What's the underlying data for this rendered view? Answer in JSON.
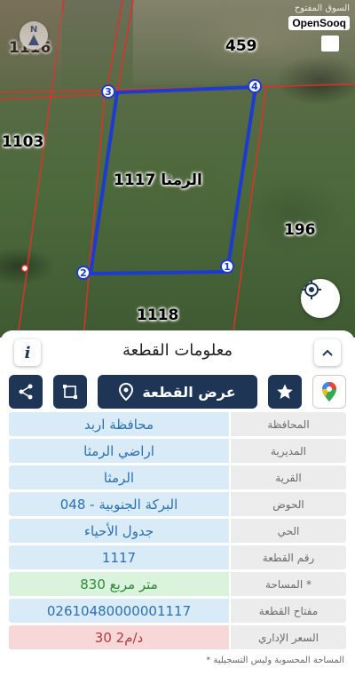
{
  "map": {
    "parcel_numbers": {
      "n1116": "1116",
      "n459": "459",
      "n1103": "1103",
      "n196": "196",
      "n1118": "1118"
    },
    "selected_parcel_label": "الرمثا 1117",
    "vertices": [
      "1",
      "2",
      "3",
      "4"
    ],
    "north_label": "N",
    "watermark_ar": "السوق المفتوح",
    "watermark_en": "OpenSooq",
    "colors": {
      "parcel_outline": "#1d3bd1",
      "boundary": "#e0302a"
    }
  },
  "sheet": {
    "title": "معلومات القطعة",
    "show_plot_label": "عرض القطعة",
    "rows": [
      {
        "label": "المحافظة",
        "value": "محافظة اربد"
      },
      {
        "label": "المديرية",
        "value": "اراضي الرمثا"
      },
      {
        "label": "القرية",
        "value": "الرمثا"
      },
      {
        "label": "الحوض",
        "value": "البركة الجنوبية - 048"
      },
      {
        "label": "الحي",
        "value": "جدول الأحياء"
      },
      {
        "label": "رقم القطعة",
        "value": "1117"
      },
      {
        "label": "المساحة *",
        "value": "830  متر مربع"
      },
      {
        "label": "مفتاح القطعة",
        "value": "02610480000001117"
      },
      {
        "label": "السعر الإداري",
        "value": "30 د/م2"
      }
    ],
    "footnote": "* المساحة المحسوبة وليس التسجيلية",
    "colors": {
      "primary": "#1e3556",
      "value_bg": "#d9ebf6",
      "area_bg": "#d9f3dc",
      "price_bg": "#f8d7d8"
    }
  }
}
